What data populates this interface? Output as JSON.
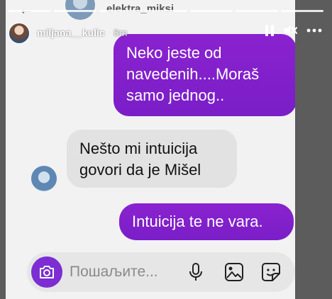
{
  "chat": {
    "peer_name": "elektra_miksi"
  },
  "story": {
    "username": "miljana__kulic",
    "time_ago": "8m"
  },
  "messages": [
    {
      "direction": "sent",
      "text": "Neko jeste od navedenih....Moraš samo jednog.."
    },
    {
      "direction": "received",
      "text": "Nešto mi intuicija govori da je Mišel"
    },
    {
      "direction": "sent",
      "text": "Intuicija te ne vara."
    }
  ],
  "composer": {
    "placeholder": "Пошаљите..."
  },
  "colors": {
    "sent_bubble": "#7a1ec8",
    "received_bubble": "#e2e2e2",
    "camera_button": "#7c2ed3"
  },
  "icons": [
    "back-arrow-icon",
    "pause-icon",
    "mute-icon",
    "more-icon",
    "camera-icon",
    "mic-icon",
    "gallery-icon",
    "sticker-icon"
  ]
}
